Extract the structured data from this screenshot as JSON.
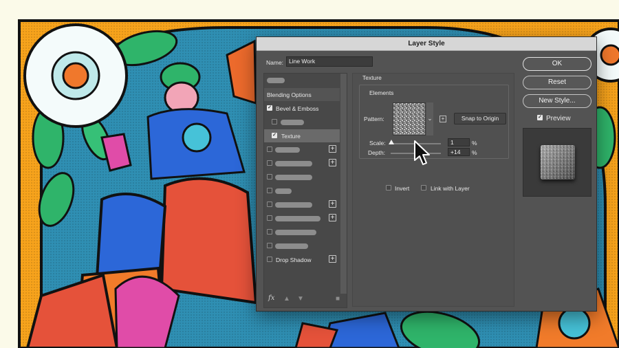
{
  "dialog": {
    "title": "Layer Style",
    "name_label": "Name:",
    "name_value": "Line Work"
  },
  "styles_list": {
    "blending_options": "Blending Options",
    "bevel_emboss": "Bevel & Emboss",
    "texture": "Texture",
    "drop_shadow": "Drop Shadow",
    "fx_label": "fx"
  },
  "texture": {
    "section_title": "Texture",
    "group_title": "Elements",
    "pattern_label": "Pattern:",
    "snap_button": "Snap to Origin",
    "scale_label": "Scale:",
    "scale_value": "1",
    "scale_unit": "%",
    "scale_fraction": 0.01,
    "depth_label": "Depth:",
    "depth_value": "+14",
    "depth_unit": "%",
    "depth_fraction": 0.57,
    "invert_label": "Invert",
    "link_label": "Link with Layer"
  },
  "buttons": {
    "ok": "OK",
    "reset": "Reset",
    "new_style": "New Style...",
    "preview": "Preview"
  },
  "colors": {
    "dialog_bg": "#535353",
    "titlebar_bg": "#d6d6d6",
    "selected_row": "#6a6a6a"
  }
}
